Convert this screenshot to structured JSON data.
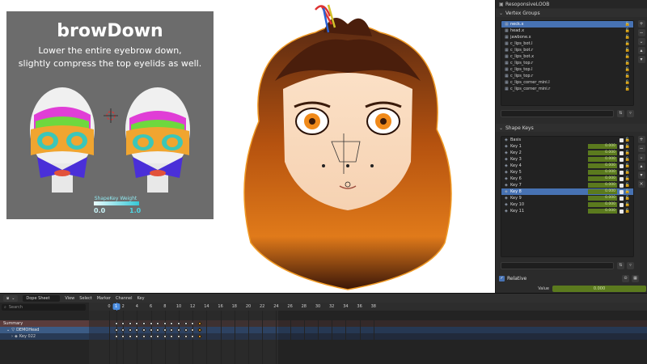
{
  "reference_card": {
    "title": "browDown",
    "description_line1": "Lower the entire eyebrow down,",
    "description_line2": "slightly compress the top eyelids as well.",
    "legend_label": "ShapeKey Weight",
    "legend_min": "0.0",
    "legend_max": "1.0"
  },
  "properties": {
    "top_item_label": "ResoponsiveLOOB",
    "vertex_groups": {
      "title": "Vertex Groups",
      "items": [
        {
          "label": "neck.x",
          "active": true
        },
        {
          "label": "head.x",
          "active": false
        },
        {
          "label": "jawbone.x",
          "active": false
        },
        {
          "label": "c_lips_bot.l",
          "active": false
        },
        {
          "label": "c_lips_bot.r",
          "active": false
        },
        {
          "label": "c_lips_bot.x",
          "active": false
        },
        {
          "label": "c_lips_top.r",
          "active": false
        },
        {
          "label": "c_lips_top.l",
          "active": false
        },
        {
          "label": "c_lips_top.r",
          "active": false
        },
        {
          "label": "c_lips_corner_mini.l",
          "active": false
        },
        {
          "label": "c_lips_corner_mini.r",
          "active": false
        }
      ]
    },
    "shape_keys": {
      "title": "Shape Keys",
      "items": [
        {
          "label": "Basis",
          "value": "",
          "active": false
        },
        {
          "label": "Key 1",
          "value": "0.000",
          "active": false
        },
        {
          "label": "Key 2",
          "value": "0.000",
          "active": false
        },
        {
          "label": "Key 3",
          "value": "0.000",
          "active": false
        },
        {
          "label": "Key 4",
          "value": "0.000",
          "active": false
        },
        {
          "label": "Key 5",
          "value": "0.000",
          "active": false
        },
        {
          "label": "Key 6",
          "value": "0.000",
          "active": false
        },
        {
          "label": "Key 7",
          "value": "0.000",
          "active": false
        },
        {
          "label": "Key 8",
          "value": "0.000",
          "active": true
        },
        {
          "label": "Key 9",
          "value": "0.000",
          "active": false
        },
        {
          "label": "Key 10",
          "value": "0.000",
          "active": false
        },
        {
          "label": "Key 11",
          "value": "0.000",
          "active": false
        }
      ],
      "relative_label": "Relative",
      "value_label": "Value",
      "value": "0.000"
    },
    "accent": "#4772b3",
    "value_color": "#5b7a1e"
  },
  "dope_sheet": {
    "mode": "Dope Sheet",
    "menus": [
      "View",
      "Select",
      "Marker",
      "Channel",
      "Key"
    ],
    "search_placeholder": "Search",
    "channels": {
      "summary": "Summary",
      "object": "DEMOHead",
      "key": "Key 022"
    },
    "frame_labels": [
      "0",
      "1",
      "2",
      "4",
      "6",
      "8",
      "10",
      "12",
      "14",
      "16",
      "18",
      "20",
      "22",
      "24",
      "26",
      "28",
      "30",
      "32",
      "34",
      "36",
      "38"
    ],
    "current_frame": "1",
    "keyframes": [
      1,
      2,
      3,
      4,
      5,
      6,
      7,
      8,
      9,
      10,
      11,
      12,
      13
    ],
    "selected_keyframe": 13
  }
}
